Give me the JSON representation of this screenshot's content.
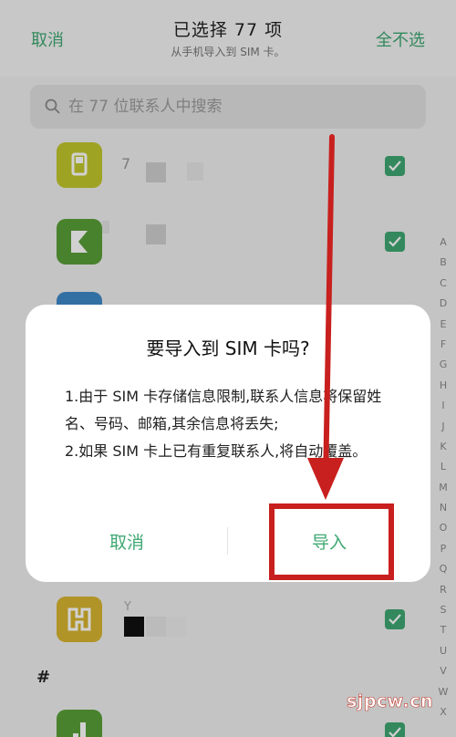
{
  "header": {
    "cancel_label": "取消",
    "title": "已选择 77 项",
    "subtitle": "从手机导入到 SIM 卡。",
    "unselect_all_label": "全不选"
  },
  "search": {
    "placeholder": "在 77 位联系人中搜索"
  },
  "contacts": [
    {
      "initial_text": "7",
      "avatar_color": "#c2c72c",
      "checked": true
    },
    {
      "initial_text": "",
      "avatar_color": "#5a9f38",
      "checked": true
    },
    {
      "initial_text": "",
      "avatar_color": "#3e89c9",
      "checked": true
    },
    {
      "initial_text": "Y",
      "avatar_color": "#d8b530",
      "checked": true
    },
    {
      "initial_text": "",
      "avatar_color": "#5a9f38",
      "checked": true
    }
  ],
  "section_header": "#",
  "alphabet_index": [
    "A",
    "B",
    "C",
    "D",
    "E",
    "F",
    "G",
    "H",
    "I",
    "J",
    "K",
    "L",
    "M",
    "N",
    "O",
    "P",
    "Q",
    "R",
    "S",
    "T",
    "U",
    "V",
    "W",
    "X"
  ],
  "dialog": {
    "title": "要导入到 SIM 卡吗?",
    "body_line_1": "1.由于 SIM 卡存储信息限制,联系人信息将保留姓名、号码、邮箱,其余信息将丢失;",
    "body_line_2": "2.如果 SIM 卡上已有重复联系人,将自动覆盖。",
    "cancel_label": "取消",
    "import_label": "导入"
  },
  "colors": {
    "accent": "#3fa872",
    "annotation": "#c8201e"
  },
  "watermark": "sjpcw.cn"
}
